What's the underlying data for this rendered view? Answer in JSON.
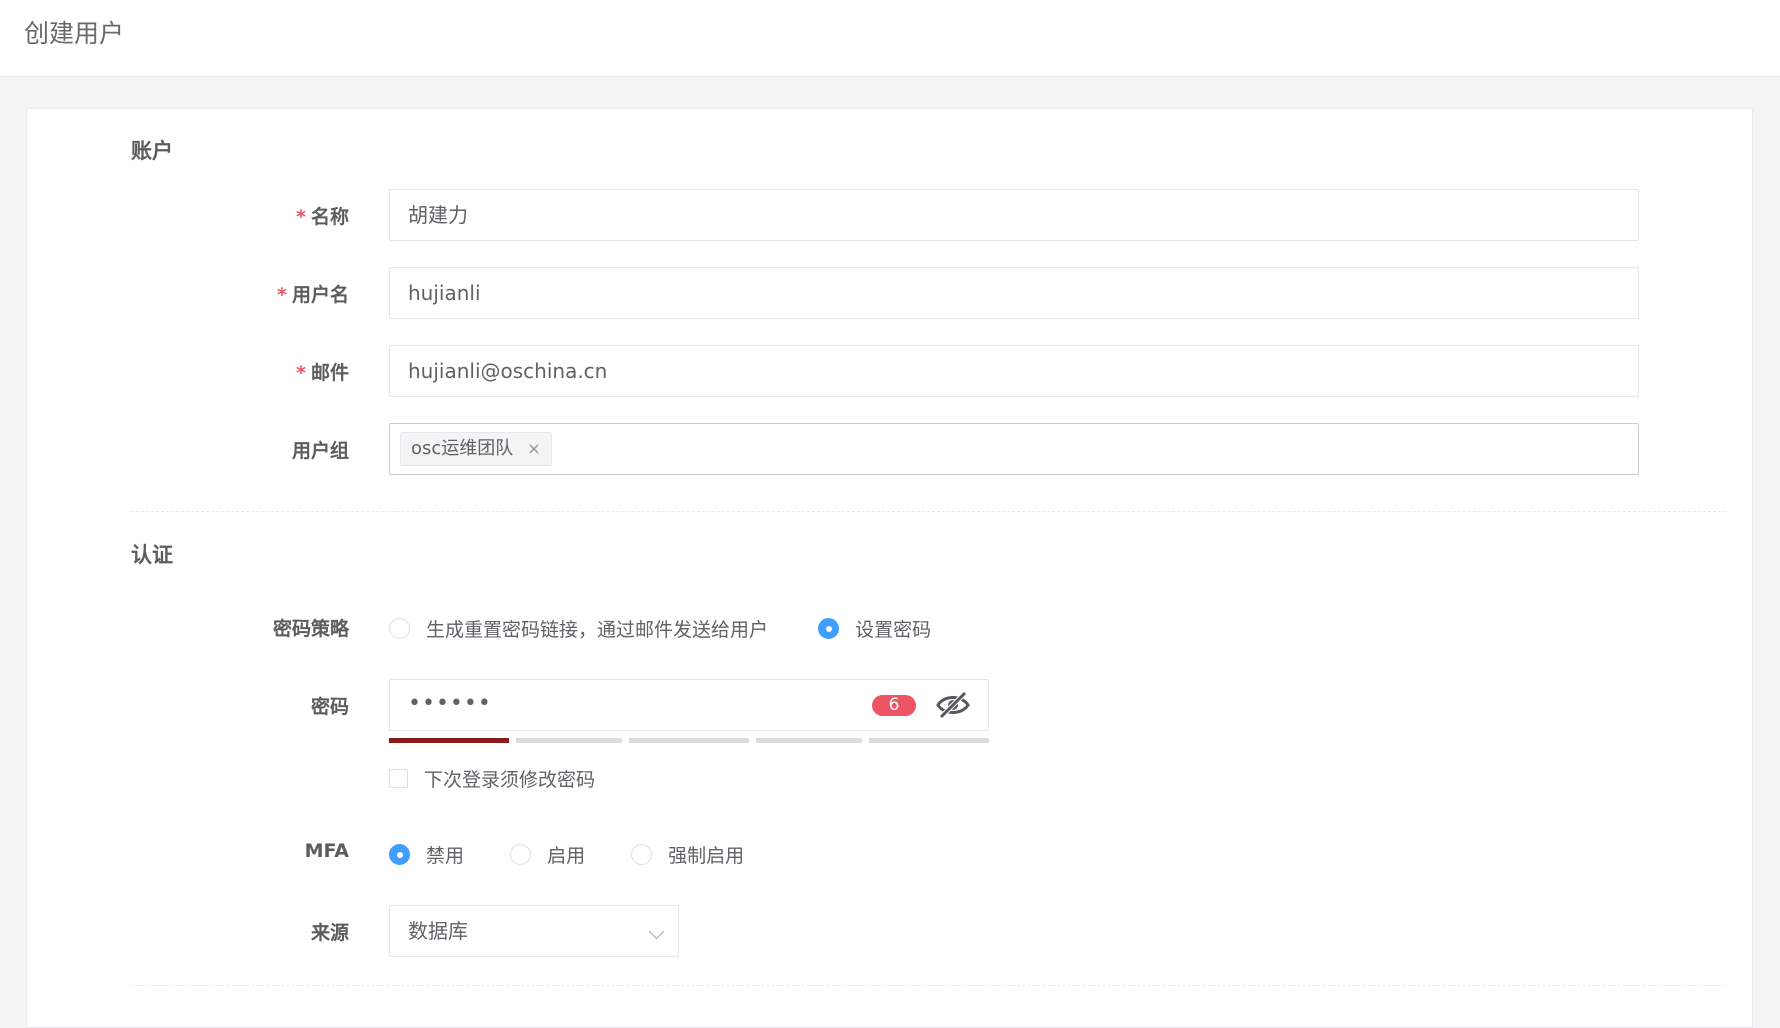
{
  "header": {
    "title": "创建用户"
  },
  "account_section": {
    "title": "账户",
    "name": {
      "label": "名称",
      "required_mark": "*",
      "value": "胡建力"
    },
    "username": {
      "label": "用户名",
      "required_mark": "*",
      "value": "hujianli"
    },
    "email": {
      "label": "邮件",
      "required_mark": "*",
      "value": "hujianli@oschina.cn"
    },
    "user_group": {
      "label": "用户组",
      "tags": [
        {
          "label": "osc运维团队",
          "close": "×"
        }
      ]
    }
  },
  "auth_section": {
    "title": "认证",
    "password_strategy": {
      "label": "密码策略",
      "options": [
        {
          "label": "生成重置密码链接，通过邮件发送给用户",
          "checked": false
        },
        {
          "label": "设置密码",
          "checked": true
        }
      ]
    },
    "password": {
      "label": "密码",
      "masked_value": "••••••",
      "length_badge": "6",
      "visibility_icon": "eye-off-icon",
      "strength_segments_total": 5,
      "strength_segments_filled": 1
    },
    "must_change_on_next_login": {
      "label": "下次登录须修改密码",
      "checked": false
    },
    "mfa": {
      "label": "MFA",
      "options": [
        {
          "label": "禁用",
          "checked": true
        },
        {
          "label": "启用",
          "checked": false
        },
        {
          "label": "强制启用",
          "checked": false
        }
      ]
    },
    "source": {
      "label": "来源",
      "selected": "数据库"
    }
  },
  "colors": {
    "accent": "#409eff",
    "required": "#ed5565",
    "badge": "#ed5565",
    "strength_weak": "#8b1a1a"
  }
}
